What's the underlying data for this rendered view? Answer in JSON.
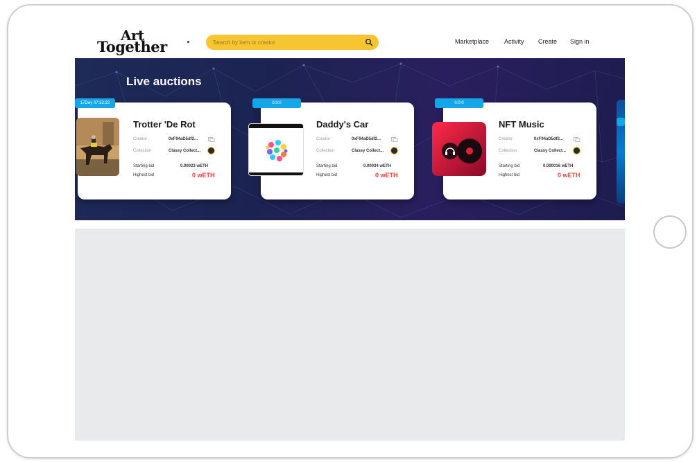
{
  "header": {
    "logo_line1": "Art",
    "logo_line2": "Together",
    "search_placeholder": "Search by item or creator",
    "nav": [
      "Marketplace",
      "Activity",
      "Create",
      "Sign in"
    ]
  },
  "banner": {
    "title": "Live auctions"
  },
  "labels": {
    "creator": "Creator",
    "collection": "Collection",
    "starting_bid": "Starting bid",
    "highest_bid": "Highest bid"
  },
  "cards": [
    {
      "timer": "17Dey 07:32:22",
      "title": "Trotter 'De Rot",
      "creator": "0xF94aD5df2...",
      "collection": "Classy Collect...",
      "starting_bid": "0.00023 wETH",
      "highest_bid": "0 wETH"
    },
    {
      "timer": "0:0:0",
      "title": "Daddy's Car",
      "creator": "0xF94aD5df2...",
      "collection": "Classy Collect...",
      "starting_bid": "0.00034 wETH",
      "highest_bid": "0 wETH"
    },
    {
      "timer": "0:0:0",
      "title": "NFT Music",
      "creator": "0xF94aD5df2...",
      "collection": "Classy Collect...",
      "starting_bid": "0.000016 wETH",
      "highest_bid": "0 wETH"
    }
  ],
  "colors": {
    "accent_yellow": "#f6c531",
    "timer_blue": "#14a6e8",
    "bid_red": "#f04040",
    "banner_dark": "#1e2a58"
  }
}
